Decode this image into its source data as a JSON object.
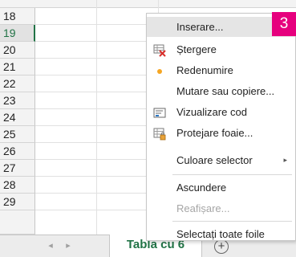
{
  "rows": [
    "18",
    "19",
    "20",
    "21",
    "22",
    "23",
    "24",
    "25",
    "26",
    "27",
    "28",
    "29"
  ],
  "active_row": "19",
  "sheet_tab": {
    "label": "Tabla cu 6"
  },
  "add_sheet": {
    "label": "+"
  },
  "nav": {
    "prev": "◂",
    "next": "▸"
  },
  "menu": {
    "items": [
      {
        "label": "Inserare...",
        "icon": "",
        "highlight": true
      },
      {
        "label": "Ștergere",
        "icon": "delete-sheet-icon"
      },
      {
        "label": "Redenumire",
        "icon": "bullet-dot-icon"
      },
      {
        "label": "Mutare sau copiere...",
        "icon": ""
      },
      {
        "label": "Vizualizare cod",
        "icon": "view-code-icon"
      },
      {
        "label": "Protejare foaie...",
        "icon": "protect-sheet-icon"
      },
      {
        "label": "Culoare selector",
        "icon": "",
        "submenu_arrow": "▸"
      },
      {
        "label": "Ascundere",
        "icon": ""
      },
      {
        "label": "Reafișare...",
        "icon": "",
        "disabled": true
      },
      {
        "label": "Selectați toate foile",
        "icon": ""
      }
    ]
  },
  "badge": {
    "label": "3"
  },
  "colors": {
    "accent_green": "#217346",
    "badge_magenta": "#e6007e",
    "bullet_orange": "#f5a623"
  }
}
